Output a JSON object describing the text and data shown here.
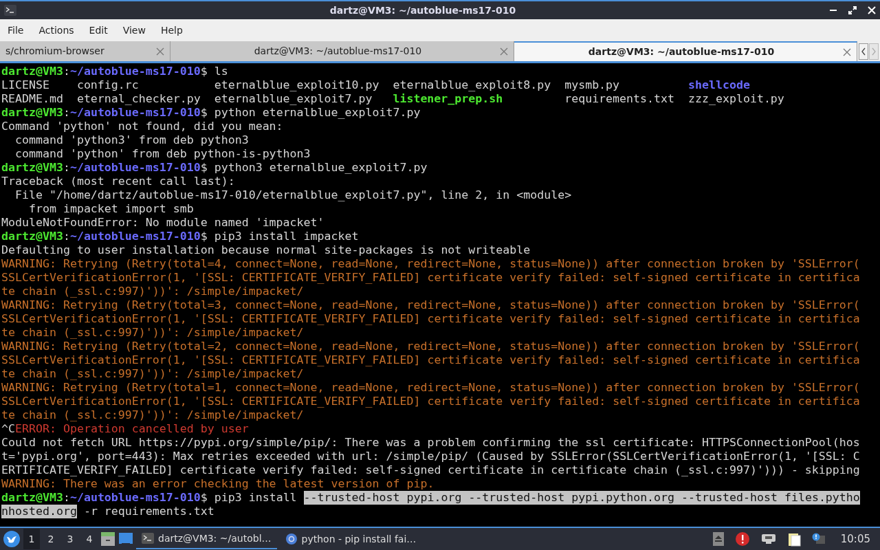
{
  "window": {
    "title": "dartz@VM3: ~/autoblue-ms17-010"
  },
  "menu": [
    "File",
    "Actions",
    "Edit",
    "View",
    "Help"
  ],
  "tabs": [
    {
      "label": "s/chromium-browser",
      "selected": false
    },
    {
      "label": "dartz@VM3: ~/autoblue-ms17-010",
      "selected": false
    },
    {
      "label": "dartz@VM3: ~/autoblue-ms17-010",
      "selected": true
    }
  ],
  "terminal": {
    "lines": [
      {
        "kind": "text",
        "segments": [
          {
            "kind": "user",
            "text": "dartz@VM3"
          },
          {
            "kind": "plain",
            "text": ":"
          },
          {
            "kind": "path",
            "text": "~/autoblue-ms17-010"
          },
          {
            "kind": "plain",
            "text": "$ ls"
          }
        ]
      },
      {
        "kind": "ls",
        "entries": [
          {
            "kind": "file",
            "text": "LICENSE"
          },
          {
            "kind": "file",
            "text": "config.rc"
          },
          {
            "kind": "file",
            "text": "eternalblue_exploit10.py"
          },
          {
            "kind": "file",
            "text": "eternalblue_exploit8.py"
          },
          {
            "kind": "file",
            "text": "mysmb.py"
          },
          {
            "kind": "dir",
            "text": "shellcode"
          }
        ]
      },
      {
        "kind": "ls",
        "entries": [
          {
            "kind": "file",
            "text": "README.md"
          },
          {
            "kind": "file",
            "text": "eternal_checker.py"
          },
          {
            "kind": "file",
            "text": "eternalblue_exploit7.py"
          },
          {
            "kind": "exec",
            "text": "listener_prep.sh"
          },
          {
            "kind": "file",
            "text": "requirements.txt"
          },
          {
            "kind": "file",
            "text": "zzz_exploit.py"
          }
        ]
      },
      {
        "kind": "text",
        "segments": [
          {
            "kind": "user",
            "text": "dartz@VM3"
          },
          {
            "kind": "plain",
            "text": ":"
          },
          {
            "kind": "path",
            "text": "~/autoblue-ms17-010"
          },
          {
            "kind": "plain",
            "text": "$ python eternalblue_exploit7.py"
          }
        ]
      },
      {
        "kind": "text",
        "segments": [
          {
            "kind": "plain",
            "text": "Command 'python' not found, did you mean:"
          }
        ]
      },
      {
        "kind": "text",
        "segments": [
          {
            "kind": "plain",
            "text": "  command 'python3' from deb python3"
          }
        ]
      },
      {
        "kind": "text",
        "segments": [
          {
            "kind": "plain",
            "text": "  command 'python' from deb python-is-python3"
          }
        ]
      },
      {
        "kind": "text",
        "segments": [
          {
            "kind": "user",
            "text": "dartz@VM3"
          },
          {
            "kind": "plain",
            "text": ":"
          },
          {
            "kind": "path",
            "text": "~/autoblue-ms17-010"
          },
          {
            "kind": "plain",
            "text": "$ python3 eternalblue_exploit7.py"
          }
        ]
      },
      {
        "kind": "text",
        "segments": [
          {
            "kind": "plain",
            "text": "Traceback (most recent call last):"
          }
        ]
      },
      {
        "kind": "text",
        "segments": [
          {
            "kind": "plain",
            "text": "  File \"/home/dartz/autoblue-ms17-010/eternalblue_exploit7.py\", line 2, in <module>"
          }
        ]
      },
      {
        "kind": "text",
        "segments": [
          {
            "kind": "plain",
            "text": "    from impacket import smb"
          }
        ]
      },
      {
        "kind": "text",
        "segments": [
          {
            "kind": "plain",
            "text": "ModuleNotFoundError: No module named 'impacket'"
          }
        ]
      },
      {
        "kind": "text",
        "segments": [
          {
            "kind": "user",
            "text": "dartz@VM3"
          },
          {
            "kind": "plain",
            "text": ":"
          },
          {
            "kind": "path",
            "text": "~/autoblue-ms17-010"
          },
          {
            "kind": "plain",
            "text": "$ pip3 install impacket"
          }
        ]
      },
      {
        "kind": "text",
        "segments": [
          {
            "kind": "plain",
            "text": "Defaulting to user installation because normal site-packages is not writeable"
          }
        ]
      },
      {
        "kind": "text",
        "segments": [
          {
            "kind": "warning",
            "text": "WARNING: Retrying (Retry(total=4, connect=None, read=None, redirect=None, status=None)) after connection broken by 'SSLError("
          }
        ]
      },
      {
        "kind": "text",
        "segments": [
          {
            "kind": "warning",
            "text": "SSLCertVerificationError(1, '[SSL: CERTIFICATE_VERIFY_FAILED] certificate verify failed: self-signed certificate in certifica"
          }
        ]
      },
      {
        "kind": "text",
        "segments": [
          {
            "kind": "warning",
            "text": "te chain (_ssl.c:997)'))': /simple/impacket/"
          }
        ]
      },
      {
        "kind": "text",
        "segments": [
          {
            "kind": "warning",
            "text": "WARNING: Retrying (Retry(total=3, connect=None, read=None, redirect=None, status=None)) after connection broken by 'SSLError("
          }
        ]
      },
      {
        "kind": "text",
        "segments": [
          {
            "kind": "warning",
            "text": "SSLCertVerificationError(1, '[SSL: CERTIFICATE_VERIFY_FAILED] certificate verify failed: self-signed certificate in certifica"
          }
        ]
      },
      {
        "kind": "text",
        "segments": [
          {
            "kind": "warning",
            "text": "te chain (_ssl.c:997)'))': /simple/impacket/"
          }
        ]
      },
      {
        "kind": "text",
        "segments": [
          {
            "kind": "warning",
            "text": "WARNING: Retrying (Retry(total=2, connect=None, read=None, redirect=None, status=None)) after connection broken by 'SSLError("
          }
        ]
      },
      {
        "kind": "text",
        "segments": [
          {
            "kind": "warning",
            "text": "SSLCertVerificationError(1, '[SSL: CERTIFICATE_VERIFY_FAILED] certificate verify failed: self-signed certificate in certifica"
          }
        ]
      },
      {
        "kind": "text",
        "segments": [
          {
            "kind": "warning",
            "text": "te chain (_ssl.c:997)'))': /simple/impacket/"
          }
        ]
      },
      {
        "kind": "text",
        "segments": [
          {
            "kind": "warning",
            "text": "WARNING: Retrying (Retry(total=1, connect=None, read=None, redirect=None, status=None)) after connection broken by 'SSLError("
          }
        ]
      },
      {
        "kind": "text",
        "segments": [
          {
            "kind": "warning",
            "text": "SSLCertVerificationError(1, '[SSL: CERTIFICATE_VERIFY_FAILED] certificate verify failed: self-signed certificate in certifica"
          }
        ]
      },
      {
        "kind": "text",
        "segments": [
          {
            "kind": "warning",
            "text": "te chain (_ssl.c:997)'))': /simple/impacket/"
          }
        ]
      },
      {
        "kind": "text",
        "segments": [
          {
            "kind": "plain",
            "text": "^C"
          },
          {
            "kind": "error",
            "text": "ERROR: Operation cancelled by user"
          }
        ]
      },
      {
        "kind": "text",
        "segments": [
          {
            "kind": "plain",
            "text": "Could not fetch URL https://pypi.org/simple/pip/: There was a problem confirming the ssl certificate: HTTPSConnectionPool(hos"
          }
        ]
      },
      {
        "kind": "text",
        "segments": [
          {
            "kind": "plain",
            "text": "t='pypi.org', port=443): Max retries exceeded with url: /simple/pip/ (Caused by SSLError(SSLCertVerificationError(1, '[SSL: C"
          }
        ]
      },
      {
        "kind": "text",
        "segments": [
          {
            "kind": "plain",
            "text": "ERTIFICATE_VERIFY_FAILED] certificate verify failed: self-signed certificate in certificate chain (_ssl.c:997)'))) - skipping"
          }
        ]
      },
      {
        "kind": "text",
        "segments": [
          {
            "kind": "warning",
            "text": "WARNING: There was an error checking the latest version of pip."
          }
        ]
      },
      {
        "kind": "text",
        "segments": [
          {
            "kind": "user",
            "text": "dartz@VM3"
          },
          {
            "kind": "plain",
            "text": ":"
          },
          {
            "kind": "path",
            "text": "~/autoblue-ms17-010"
          },
          {
            "kind": "plain",
            "text": "$ pip3 install "
          },
          {
            "kind": "selected",
            "text": "--trusted-host pypi.org --trusted-host pypi.python.org --trusted-host files.pytho"
          }
        ]
      },
      {
        "kind": "text",
        "segments": [
          {
            "kind": "selected",
            "text": "nhosted.org"
          },
          {
            "kind": "plain",
            "text": " -r requirements.txt"
          }
        ]
      }
    ]
  },
  "taskbar": {
    "workspaces": [
      {
        "label": "1",
        "selected": true
      },
      {
        "label": "2",
        "selected": false
      },
      {
        "label": "3",
        "selected": false
      },
      {
        "label": "4",
        "selected": false
      }
    ],
    "tasks": [
      {
        "kind": "terminal",
        "label": "dartz@VM3: ~/autobl…",
        "selected": true
      },
      {
        "kind": "browser",
        "label": "python - pip install fai…",
        "selected": false
      }
    ],
    "clock": "10:05"
  }
}
